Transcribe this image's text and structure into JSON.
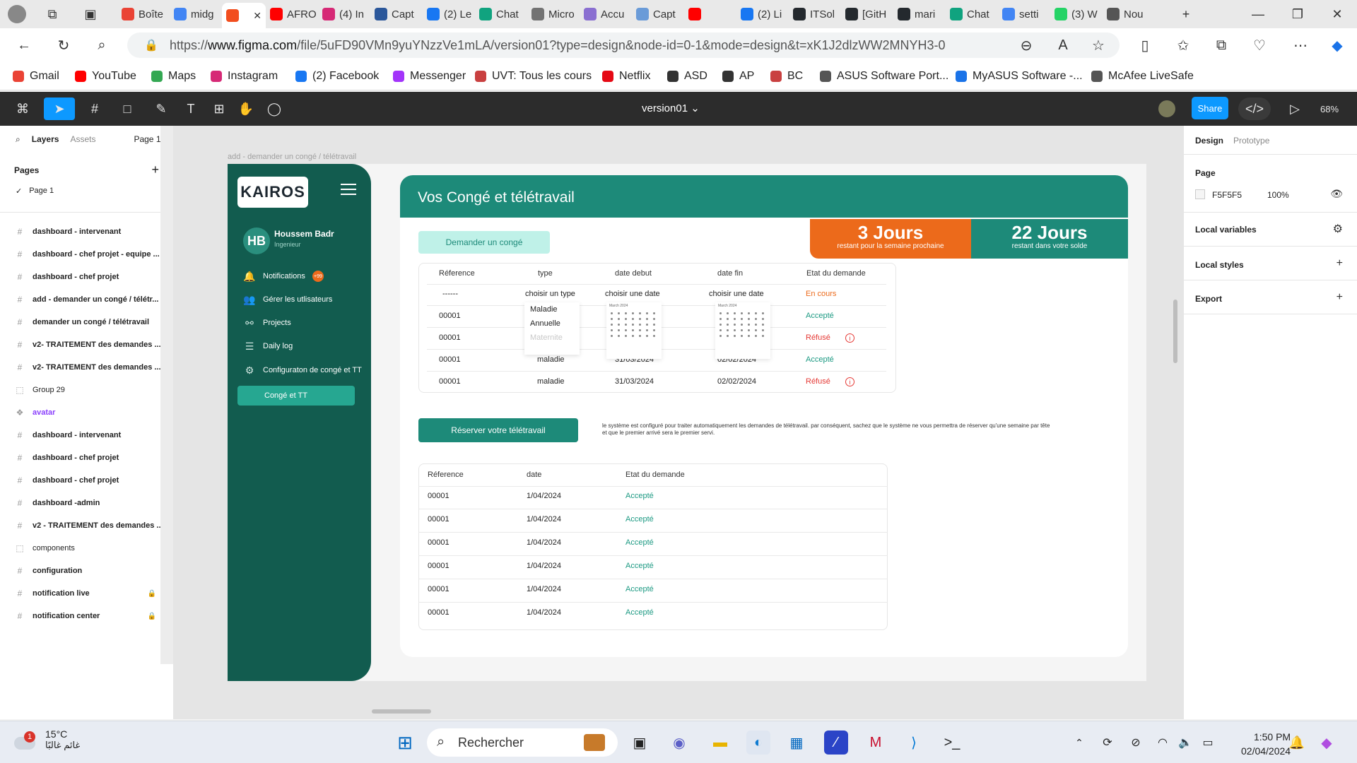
{
  "browser": {
    "tabs": [
      {
        "label": "Boîte",
        "icon": "gmail"
      },
      {
        "label": "midg",
        "icon": "docs"
      },
      {
        "label": "",
        "icon": "figma",
        "active": true
      },
      {
        "label": "AFRO",
        "icon": "youtube"
      },
      {
        "label": "(4) In",
        "icon": "instagram"
      },
      {
        "label": "Capt",
        "icon": "word"
      },
      {
        "label": "(2) Le",
        "icon": "facebook"
      },
      {
        "label": "Chat",
        "icon": "chatgpt"
      },
      {
        "label": "Micro",
        "icon": "microsoft"
      },
      {
        "label": "Accu",
        "icon": "copilot"
      },
      {
        "label": "Capt",
        "icon": "image"
      },
      {
        "label": "",
        "icon": "youtube"
      },
      {
        "label": "(2) Li",
        "icon": "facebook"
      },
      {
        "label": "ITSol",
        "icon": "github"
      },
      {
        "label": "[GitH",
        "icon": "github"
      },
      {
        "label": "mari",
        "icon": "github"
      },
      {
        "label": "Chat",
        "icon": "chatgpt"
      },
      {
        "label": "setti",
        "icon": "search"
      },
      {
        "label": "(3) W",
        "icon": "whatsapp"
      },
      {
        "label": "Nou",
        "icon": "newtab"
      }
    ],
    "url_prefix": "https://",
    "url_host": "www.figma.com",
    "url_rest": "/file/5uFD90VMn9yuYNzzVe1mLA/version01?type=design&node-id=0-1&mode=design&t=xK1J2dlzWW2MNYH3-0",
    "bookmarks": [
      {
        "label": "Gmail",
        "icon": "gmail-icon",
        "color": "#ea4335"
      },
      {
        "label": "YouTube",
        "icon": "youtube-icon",
        "color": "#ff0000"
      },
      {
        "label": "Maps",
        "icon": "maps-icon",
        "color": "#34a853"
      },
      {
        "label": "Instagram",
        "icon": "instagram-icon",
        "color": "#d62976"
      },
      {
        "label": "(2) Facebook",
        "icon": "facebook-icon",
        "color": "#1877f2"
      },
      {
        "label": "Messenger",
        "icon": "messenger-icon",
        "color": "#a334fa"
      },
      {
        "label": "UVT: Tous les cours",
        "icon": "uvt-icon",
        "color": "#c94040"
      },
      {
        "label": "Netflix",
        "icon": "netflix-icon",
        "color": "#e50914"
      },
      {
        "label": "ASD",
        "icon": "m-icon",
        "color": "#333333"
      },
      {
        "label": "AP",
        "icon": "m-icon",
        "color": "#333333"
      },
      {
        "label": "BC",
        "icon": "uvt-icon",
        "color": "#c94040"
      },
      {
        "label": "ASUS Software Port...",
        "icon": "page-icon",
        "color": "#555555"
      },
      {
        "label": "MyASUS Software -...",
        "icon": "asus-icon",
        "color": "#1a73e8"
      },
      {
        "label": "McAfee LiveSafe",
        "icon": "page-icon",
        "color": "#555555"
      }
    ]
  },
  "figma": {
    "file_title": "version01",
    "share_label": "Share",
    "zoom": "68%",
    "left_tabs": {
      "layers": "Layers",
      "assets": "Assets",
      "page_select": "Page 1"
    },
    "pages_header": "Pages",
    "current_page": "Page 1",
    "layers": [
      {
        "label": "dashboard - intervenant",
        "kind": "frame"
      },
      {
        "label": "dashboard - chef projet - equipe ...",
        "kind": "frame"
      },
      {
        "label": "dashboard - chef projet",
        "kind": "frame"
      },
      {
        "label": "add - demander un congé / télétr...",
        "kind": "frame"
      },
      {
        "label": "demander un congé / télétravail",
        "kind": "frame"
      },
      {
        "label": "v2- TRAITEMENT des demandes ...",
        "kind": "frame"
      },
      {
        "label": "v2- TRAITEMENT des demandes ...",
        "kind": "frame"
      },
      {
        "label": "Group 29",
        "kind": "group"
      },
      {
        "label": "avatar",
        "kind": "component"
      },
      {
        "label": "dashboard - intervenant",
        "kind": "frame"
      },
      {
        "label": "dashboard - chef projet",
        "kind": "frame"
      },
      {
        "label": "dashboard - chef projet",
        "kind": "frame"
      },
      {
        "label": "dashboard -admin",
        "kind": "frame"
      },
      {
        "label": "v2 - TRAITEMENT des demandes ...",
        "kind": "frame"
      },
      {
        "label": "components",
        "kind": "group"
      },
      {
        "label": "configuration",
        "kind": "frame"
      },
      {
        "label": "notification live",
        "kind": "frame",
        "locked": true
      },
      {
        "label": "notification center",
        "kind": "frame",
        "locked": true
      }
    ],
    "right": {
      "design_tab": "Design",
      "prototype_tab": "Prototype",
      "page_section": "Page",
      "page_color": "F5F5F5",
      "page_opacity": "100%",
      "local_variables": "Local variables",
      "local_styles": "Local styles",
      "export": "Export"
    },
    "frame_label": "add - demander un congé / télétravail"
  },
  "app": {
    "logo": "KAIROS",
    "user": {
      "initials": "HB",
      "name": "Houssem Badr",
      "role": "Ingenieur"
    },
    "menu": [
      {
        "label": "Notifications",
        "icon": "bell-icon",
        "badge": "+99"
      },
      {
        "label": "Gérer les utlisateurs",
        "icon": "users-icon"
      },
      {
        "label": "Projects",
        "icon": "projects-icon"
      },
      {
        "label": "Daily log",
        "icon": "list-icon"
      },
      {
        "label": "Configuraton de congé et TT",
        "icon": "gears-icon"
      }
    ],
    "active_menu": "Congé et TT",
    "page_title": "Vos Congé et télétravail",
    "stat_week": {
      "value": "3 Jours",
      "caption": "restant pour la semaine prochaine"
    },
    "stat_balance": {
      "value": "22 Jours",
      "caption": "restant dans votre solde"
    },
    "request_button": "Demander un congé",
    "leave_table": {
      "headers": [
        "Réference",
        "type",
        "date debut",
        "date fin",
        "Etat du demande"
      ],
      "input_row": {
        "ref": "------",
        "type": "choisir un type",
        "start": "choisir une date",
        "end": "choisir une date",
        "status": "En cours"
      },
      "rows": [
        {
          "ref": "00001",
          "type": "",
          "start": "",
          "end": "",
          "status": "Accepté",
          "state": "ok"
        },
        {
          "ref": "00001",
          "type": "",
          "start": "",
          "end": "",
          "status": "Réfusé",
          "state": "ko"
        },
        {
          "ref": "00001",
          "type": "maladie",
          "start": "31/03/2024",
          "end": "02/02/2024",
          "status": "Accepté",
          "state": "ok"
        },
        {
          "ref": "00001",
          "type": "maladie",
          "start": "31/03/2024",
          "end": "02/02/2024",
          "status": "Réfusé",
          "state": "ko"
        }
      ],
      "type_options": [
        "Maladie",
        "Annuelle",
        "Maternite"
      ],
      "calendar_month": "March 2024"
    },
    "telework_button": "Réserver votre télétravail",
    "telework_note": "le système est configuré pour traiter automatiquement les demandes de télétravail. par conséquent, sachez que le système ne vous permettra de réserver qu'une semaine par tête et que le premier arrivé sera le premier servi.",
    "telework_table": {
      "headers": [
        "Réference",
        "date",
        "Etat du demande"
      ],
      "rows": [
        {
          "ref": "00001",
          "date": "1/04/2024",
          "status": "Accepté"
        },
        {
          "ref": "00001",
          "date": "1/04/2024",
          "status": "Accepté"
        },
        {
          "ref": "00001",
          "date": "1/04/2024",
          "status": "Accepté"
        },
        {
          "ref": "00001",
          "date": "1/04/2024",
          "status": "Accepté"
        },
        {
          "ref": "00001",
          "date": "1/04/2024",
          "status": "Accepté"
        },
        {
          "ref": "00001",
          "date": "1/04/2024",
          "status": "Accepté"
        }
      ]
    }
  },
  "taskbar": {
    "weather_temp": "15°C",
    "weather_desc": "غائم غالبًا",
    "weather_badge": "1",
    "search_placeholder": "Rechercher",
    "time": "1:50 PM",
    "date": "02/04/2024"
  }
}
